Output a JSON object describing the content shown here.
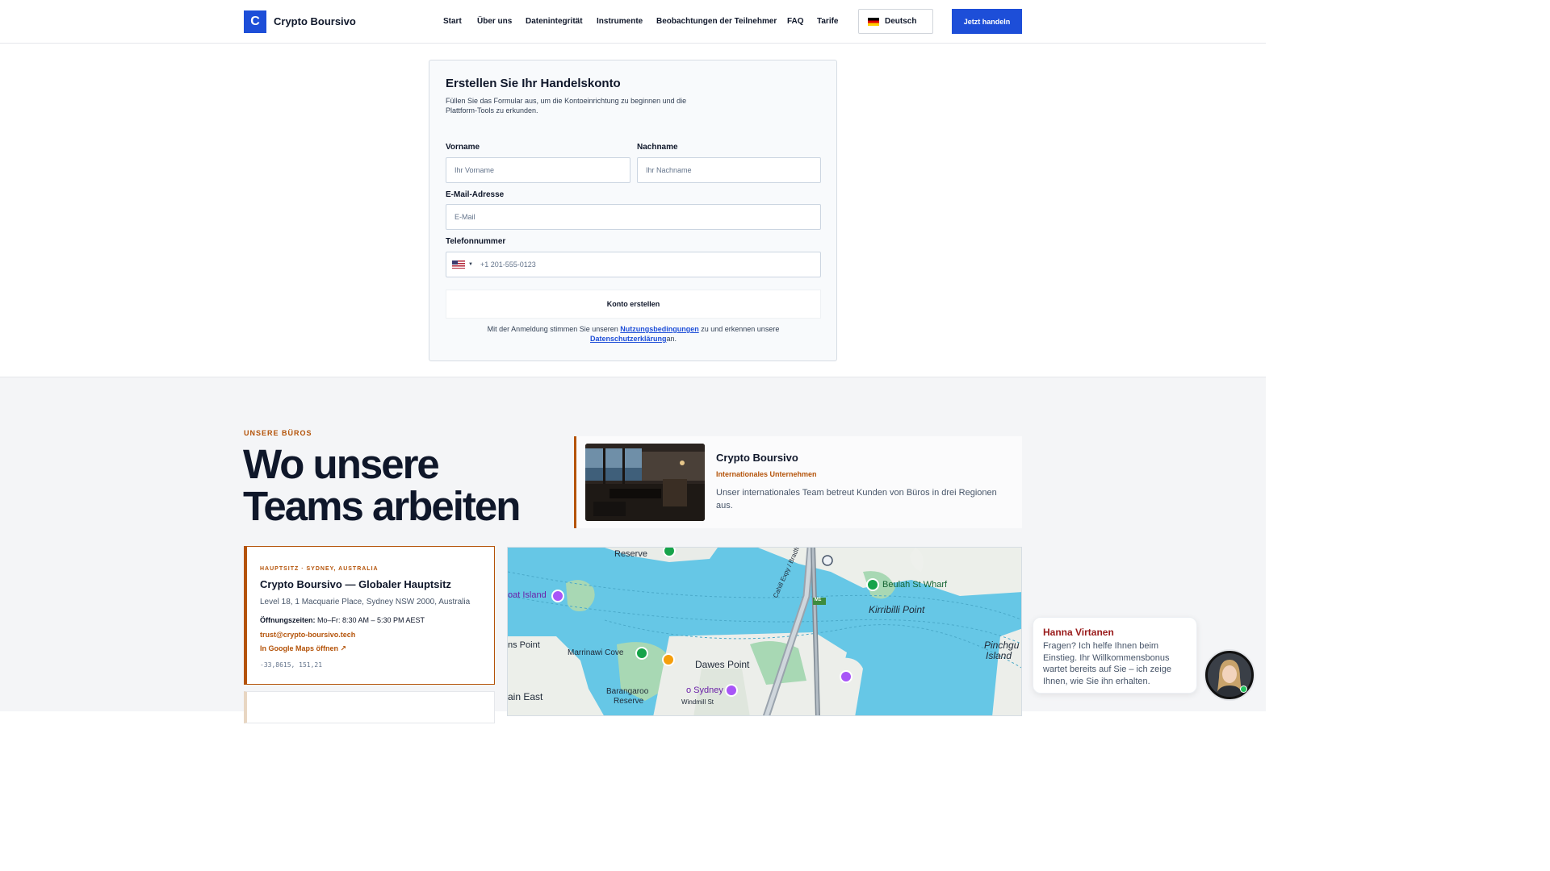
{
  "header": {
    "logo_letter": "C",
    "brand": "Crypto Boursivo",
    "nav": [
      "Start",
      "Über uns",
      "Datenintegrität",
      "Instrumente",
      "Beobachtungen der Teilnehmer",
      "FAQ",
      "Tarife"
    ],
    "language": "Deutsch",
    "cta": "Jetzt handeln"
  },
  "form": {
    "title": "Erstellen Sie Ihr Handelskonto",
    "subtitle": "Füllen Sie das Formular aus, um die Kontoeinrichtung zu beginnen und die Plattform-Tools zu erkunden.",
    "first_name_label": "Vorname",
    "first_name_placeholder": "Ihr Vorname",
    "last_name_label": "Nachname",
    "last_name_placeholder": "Ihr Nachname",
    "email_label": "E-Mail-Adresse",
    "email_placeholder": "E-Mail",
    "phone_label": "Telefonnummer",
    "phone_placeholder": "+1 201-555-0123",
    "submit": "Konto erstellen",
    "terms_prefix": "Mit der Anmeldung stimmen Sie unseren ",
    "terms_link": "Nutzungsbedingungen",
    "terms_middle": " zu und erkennen unsere ",
    "privacy_link": "Datenschutzerklärung",
    "terms_suffix": "an."
  },
  "offices": {
    "eyebrow": "UNSERE BÜROS",
    "title_line1": "Wo unsere",
    "title_line2": "Teams arbeiten",
    "hq_card": {
      "name": "Crypto Boursivo",
      "tag": "Internationales Unternehmen",
      "description": "Unser internationales Team betreut Kunden von Büros in drei Regionen aus."
    },
    "office": {
      "eyebrow": "HAUPTSITZ · SYDNEY, AUSTRALIA",
      "title": "Crypto Boursivo — Globaler Hauptsitz",
      "address": "Level 18, 1 Macquarie Place, Sydney NSW 2000, Australia",
      "hours_label": "Öffnungszeiten:",
      "hours_value": " Mo–Fr: 8:30 AM – 5:30 PM AEST",
      "email": "trust@crypto-boursivo.tech",
      "maps_link": "In Google Maps öffnen ↗",
      "coords": "-33,8615, 151,21"
    },
    "map_labels": {
      "reserve": "Reserve",
      "goat_island": "oat Island",
      "beulah": "Beulah St Wharf",
      "kirribilli": "Kirribilli Point",
      "ns_point": "ns Point",
      "marrinawi": "Marrinawi Cove",
      "dawes": "Dawes Point",
      "pinchgut": "Pinchgu",
      "pinchgut2": "Island",
      "barangaroo": "Barangaroo",
      "barangaroo2": "Reserve",
      "o_sydney": "o Sydney",
      "windmill": "Windmill St",
      "ain_east": "ain East",
      "highway": "Cahill Expy / Bradfield Hwy",
      "m1": "M1"
    }
  },
  "chat": {
    "name": "Hanna Virtanen",
    "message": "Fragen? Ich helfe Ihnen beim Einstieg. Ihr Willkommensbonus wartet bereits auf Sie – ich zeige Ihnen, wie Sie ihn erhalten."
  },
  "colors": {
    "brand_blue": "#1d4ed8",
    "accent_orange": "#b45309",
    "water": "#66c7e6"
  }
}
